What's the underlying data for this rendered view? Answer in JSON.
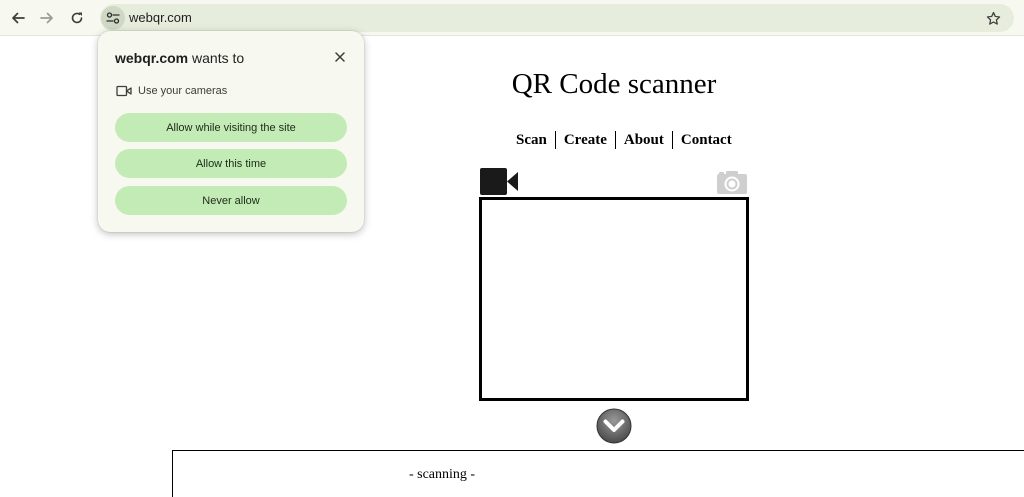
{
  "browser": {
    "url": "webqr.com",
    "icons": {
      "back": "arrow-left-icon",
      "forward": "arrow-right-icon",
      "reload": "reload-icon",
      "site_info": "site-settings-icon",
      "bookmark": "star-icon"
    }
  },
  "page": {
    "title": "QR Code scanner",
    "menu": [
      {
        "label": "Scan"
      },
      {
        "label": "Create"
      },
      {
        "label": "About"
      },
      {
        "label": "Contact"
      }
    ],
    "result_text": "- scanning -"
  },
  "permission_popup": {
    "site": "webqr.com",
    "wants_to": " wants to",
    "permission_label": "Use your cameras",
    "buttons": {
      "allow_while_visiting": "Allow while visiting the site",
      "allow_this_time": "Allow this time",
      "never_allow": "Never allow"
    }
  },
  "colors": {
    "toolbar_bg": "#f7f9f0",
    "omnibox_bg": "#e6eddc",
    "popup_bg": "#f7f8ef",
    "popup_button": "#c3ebb5"
  }
}
